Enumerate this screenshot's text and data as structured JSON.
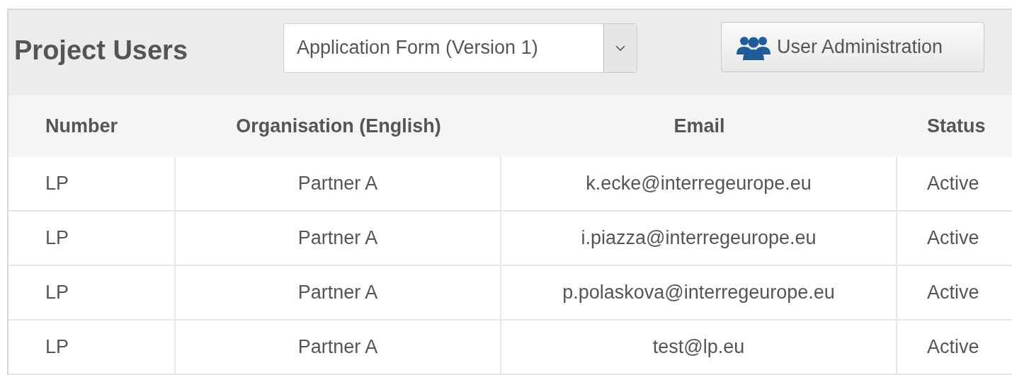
{
  "header": {
    "title": "Project Users",
    "version_select": {
      "value": "Application Form (Version 1)"
    },
    "button": "User Administration"
  },
  "table": {
    "columns": [
      "Number",
      "Organisation (English)",
      "Email",
      "Status"
    ],
    "rows": [
      {
        "number": "LP",
        "organisation": "Partner A",
        "email": "k.ecke@interregeurope.eu",
        "status": "Active"
      },
      {
        "number": "LP",
        "organisation": "Partner A",
        "email": "i.piazza@interregeurope.eu",
        "status": "Active"
      },
      {
        "number": "LP",
        "organisation": "Partner A",
        "email": "p.polaskova@interregeurope.eu",
        "status": "Active"
      },
      {
        "number": "LP",
        "organisation": "Partner A",
        "email": "test@lp.eu",
        "status": "Active"
      }
    ]
  }
}
